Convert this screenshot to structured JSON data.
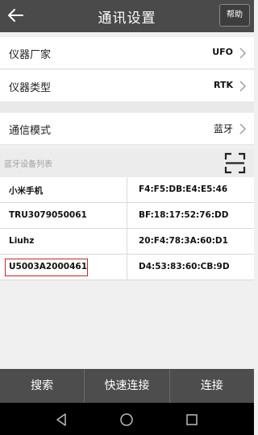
{
  "header": {
    "title": "通讯设置",
    "help_label": "帮助"
  },
  "settings": [
    {
      "label": "仪器厂家",
      "value": "UFO"
    },
    {
      "label": "仪器类型",
      "value": "RTK"
    },
    {
      "label": "通信模式",
      "value": "蓝牙"
    }
  ],
  "bluetooth_list": {
    "header": "蓝牙设备列表",
    "devices": [
      {
        "name": "小米手机",
        "mac": "F4:F5:DB:E4:E5:46"
      },
      {
        "name": "TRU3079050061",
        "mac": "BF:18:17:52:76:DD"
      },
      {
        "name": "Liuhz",
        "mac": "20:F4:78:3A:60:D1"
      },
      {
        "name": "U5003A2000461",
        "mac": "D4:53:83:60:CB:9D"
      }
    ]
  },
  "bottom_bar": {
    "search_label": "搜索",
    "quick_connect_label": "快速连接",
    "connect_label": "连接"
  },
  "colors": {
    "highlight": "#c62828",
    "topbar": "#4a4a4a",
    "bottombar": "#4d4d4d"
  }
}
